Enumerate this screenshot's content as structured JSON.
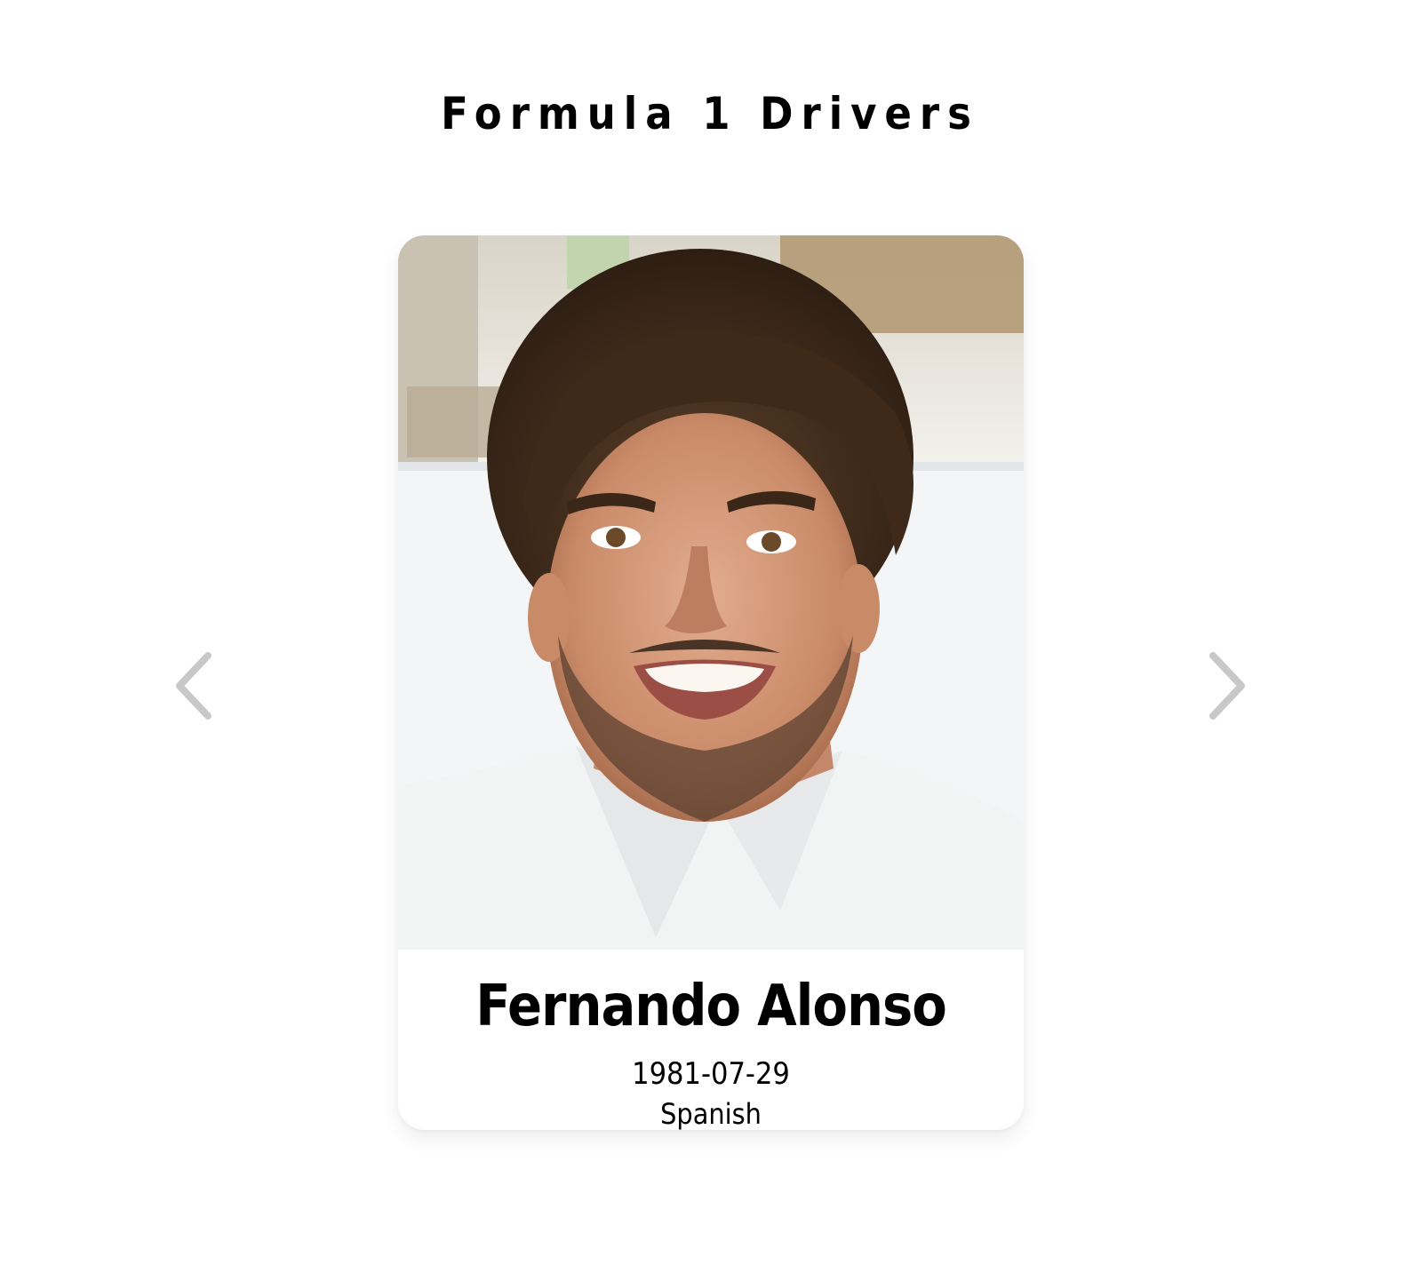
{
  "page": {
    "title": "Formula 1 Drivers"
  },
  "carousel": {
    "prev_icon": "chevron-left-icon",
    "next_icon": "chevron-right-icon",
    "arrow_color": "#c8c8c8"
  },
  "driver": {
    "name": "Fernando Alonso",
    "date_of_birth": "1981-07-29",
    "nationality": "Spanish"
  }
}
